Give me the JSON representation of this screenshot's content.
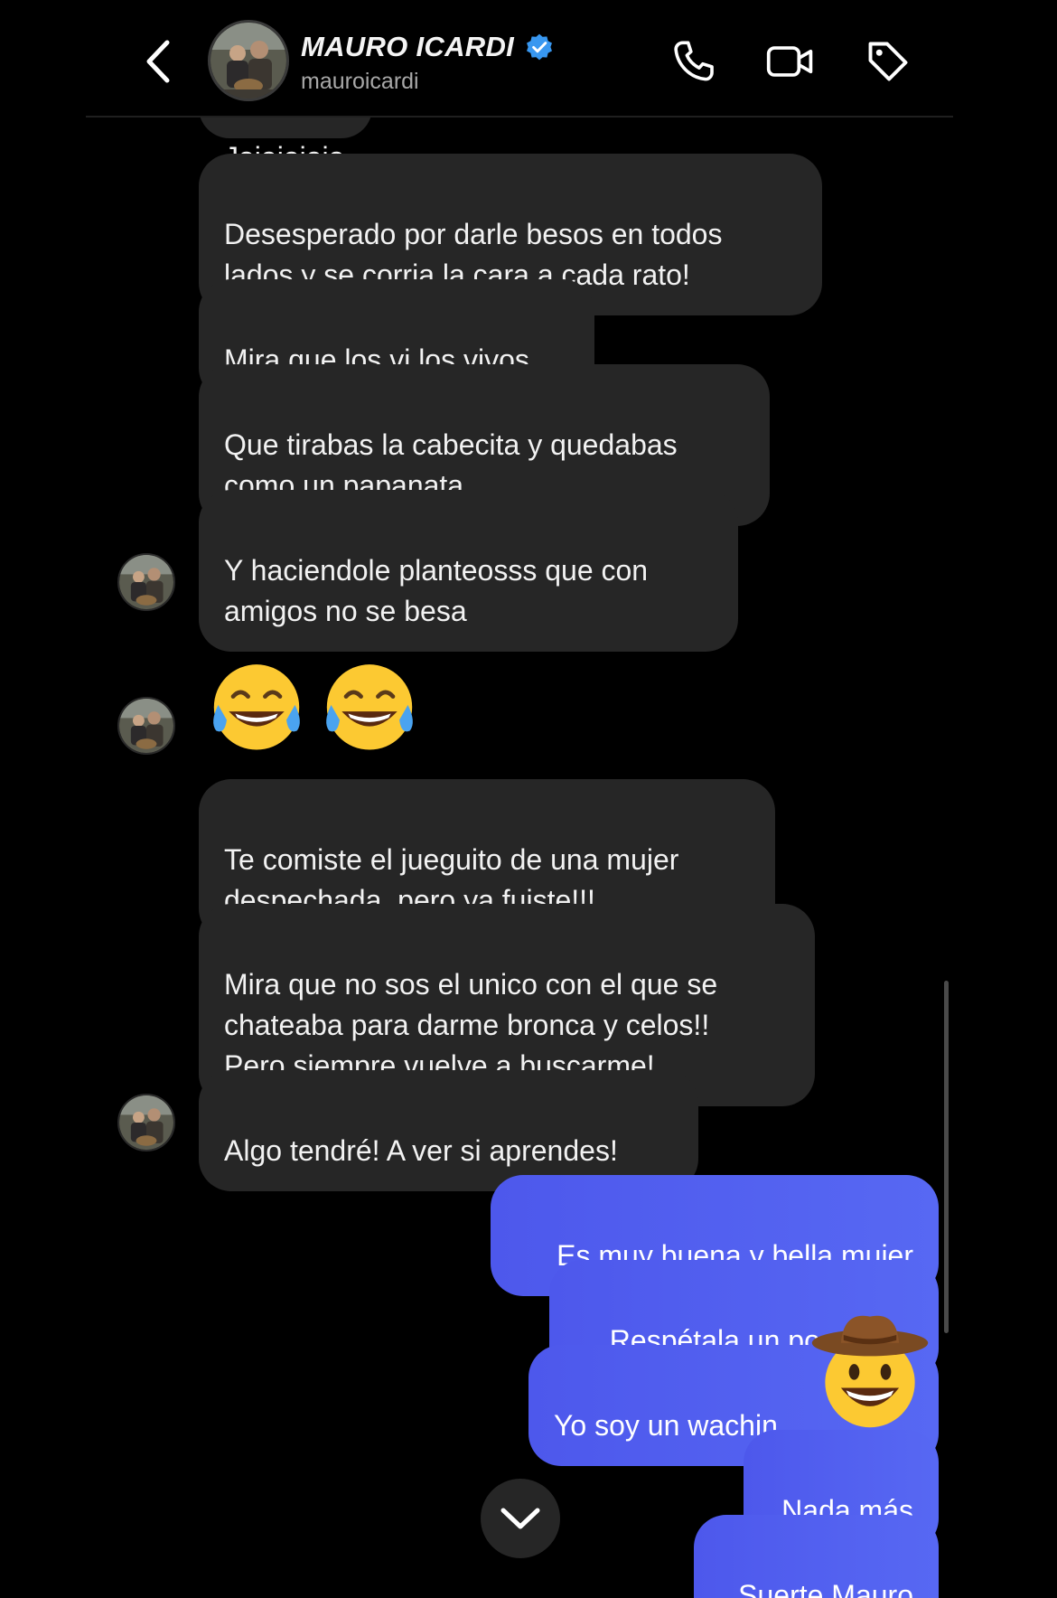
{
  "header": {
    "contact_name": "MAURO ICARDI",
    "contact_handle": "mauroicardi",
    "icons": [
      "back-chevron-icon",
      "verified-badge-icon",
      "phone-icon",
      "video-camera-icon",
      "tag-icon"
    ],
    "accent_color": "#3897f0"
  },
  "messages": {
    "partial_top": "Jajajajaja",
    "incoming": [
      "Desesperado por darle besos en todos\nlados y se corria la cara a cada rato!",
      "Mira que los vi los vivos",
      "Que tirabas la cabecita y quedabas\ncomo un papanata",
      "Y haciendole planteosss que con\namigos no se besa",
      "Te comiste el jueguito de una mujer\ndespechada, pero ya fuiste!!!",
      "Mira que no sos el unico con el que se\nchateaba para darme bronca y celos!!\nPero siempre vuelve a buscarme!",
      "Algo tendré! A ver si aprendes!"
    ],
    "emoji_message": "😂😂",
    "outgoing": [
      "Es muy buena y bella mujer",
      "Respétala un poco más",
      "Yo soy un wachin",
      "Nada más",
      "Suerte Mauro"
    ],
    "reaction_emoji": "cowboy-face-emoji"
  },
  "colors": {
    "background": "#000000",
    "incoming_bubble": "#262626",
    "outgoing_bubble": "#4f5ef0",
    "text": "#f2f2f2"
  }
}
